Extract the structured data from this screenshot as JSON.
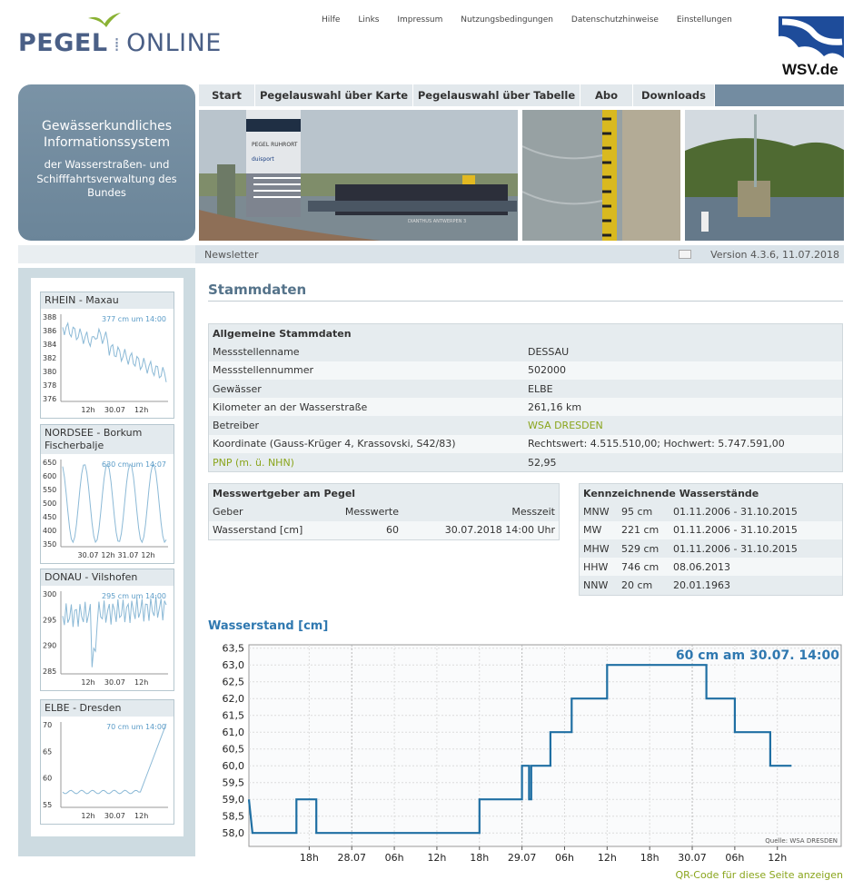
{
  "logo": {
    "part1": "PEGEL",
    "part2": "ONLINE"
  },
  "topnav": [
    "Hilfe",
    "Links",
    "Impressum",
    "Nutzungsbedingungen",
    "Datenschutzhinweise",
    "Einstellungen"
  ],
  "wsv_label": "WSV.de",
  "infobox": {
    "heading": "Gewässerkundliches Informationssystem",
    "sub": "der Wasserstraßen- und Schifffahrtsverwaltung des Bundes"
  },
  "tabs": [
    "Start",
    "Pegelauswahl über Karte",
    "Pegelauswahl über Tabelle",
    "Abo",
    "Downloads"
  ],
  "banner": {
    "sign1": "PEGEL RUHRORT",
    "sign2": "duisport",
    "ship": "DIANTHUS ANTWERPEN 3"
  },
  "newsletter": "Newsletter",
  "version": "Version 4.3.6, 11.07.2018",
  "colors": {
    "accent": "#2f78b0",
    "link": "#8aa51c",
    "nav": "#738ca1",
    "series": "#1f6fa3",
    "mini_series": "#8bb9d6"
  },
  "sidebar": [
    {
      "title": "RHEIN - Maxau",
      "label": "377 cm um 14:00",
      "yticks": [
        "388",
        "386",
        "384",
        "382",
        "380",
        "378",
        "376"
      ],
      "xticks": [
        "12h",
        "30.07",
        "12h"
      ]
    },
    {
      "title": "NORDSEE - Borkum Fischerbalje",
      "label": "630 cm um 14:07",
      "yticks": [
        "650",
        "600",
        "550",
        "500",
        "450",
        "400",
        "350"
      ],
      "xticks": [
        "30.07",
        "12h",
        "31.07",
        "12h"
      ]
    },
    {
      "title": "DONAU - Vilshofen",
      "label": "295 cm um 14:00",
      "yticks": [
        "300",
        "295",
        "290",
        "285"
      ],
      "xticks": [
        "12h",
        "30.07",
        "12h"
      ]
    },
    {
      "title": "ELBE - Dresden",
      "label": "70 cm um 14:00",
      "yticks": [
        "70",
        "65",
        "60",
        "55"
      ],
      "xticks": [
        "12h",
        "30.07",
        "12h"
      ]
    }
  ],
  "stammdaten": {
    "title": "Stammdaten",
    "section": "Allgemeine Stammdaten",
    "rows": [
      {
        "label": "Messstellenname",
        "value": "DESSAU"
      },
      {
        "label": "Messstellennummer",
        "value": "502000"
      },
      {
        "label": "Gewässer",
        "value": "ELBE"
      },
      {
        "label": "Kilometer an der Wasserstraße",
        "value": "261,16 km"
      },
      {
        "label": "Betreiber",
        "value": "WSA DRESDEN"
      },
      {
        "label": "Koordinate (Gauss-Krüger 4, Krassovski, S42/83)",
        "value": "Rechtswert: 4.515.510,00; Hochwert: 5.747.591,00"
      },
      {
        "label": "PNP (m. ü. NHN)",
        "value": "52,95"
      }
    ]
  },
  "messwert": {
    "title": "Messwertgeber am Pegel",
    "headers": [
      "Geber",
      "Messwerte",
      "Messzeit"
    ],
    "row": [
      "Wasserstand [cm]",
      "60",
      "30.07.2018 14:00 Uhr"
    ]
  },
  "kennzeichnend": {
    "title": "Kennzeichnende Wasserstände",
    "rows": [
      {
        "k": "MNW",
        "v": "95 cm",
        "d": "01.11.2006 - 31.10.2015"
      },
      {
        "k": "MW",
        "v": "221 cm",
        "d": "01.11.2006 - 31.10.2015"
      },
      {
        "k": "MHW",
        "v": "529 cm",
        "d": "01.11.2006 - 31.10.2015"
      },
      {
        "k": "HHW",
        "v": "746 cm",
        "d": "08.06.2013"
      },
      {
        "k": "NNW",
        "v": "20 cm",
        "d": "20.01.1963"
      }
    ]
  },
  "chart_data": {
    "type": "line",
    "title": "Wasserstand [cm]",
    "annotation": "60 cm am 30.07. 14:00",
    "source": "Quelle: WSA DRESDEN",
    "ylim": [
      57.6,
      63.6
    ],
    "yticks": [
      "63,5",
      "63,0",
      "62,5",
      "62,0",
      "61,5",
      "61,0",
      "60,5",
      "60,0",
      "59,5",
      "59,0",
      "58,5",
      "58,0"
    ],
    "ytick_values": [
      63.5,
      63.0,
      62.5,
      62.0,
      61.5,
      61.0,
      60.5,
      60.0,
      59.5,
      59.0,
      58.5,
      58.0
    ],
    "xlim_hours": [
      -38.5,
      45
    ],
    "xticks": [
      {
        "label": "18h",
        "h": -30
      },
      {
        "label": "28.07",
        "h": -24
      },
      {
        "label": "06h",
        "h": -18
      },
      {
        "label": "12h",
        "h": -12
      },
      {
        "label": "18h",
        "h": -6
      },
      {
        "label": "29.07",
        "h": 0
      },
      {
        "label": "06h",
        "h": 6
      },
      {
        "label": "12h",
        "h": 12
      },
      {
        "label": "18h",
        "h": 18
      },
      {
        "label": "30.07",
        "h": 24
      },
      {
        "label": "06h",
        "h": 30
      },
      {
        "label": "12h",
        "h": 36
      }
    ],
    "grid": true,
    "series": [
      {
        "values": [
          [
            -38.5,
            59.0
          ],
          [
            -38.0,
            58.0
          ],
          [
            -31.8,
            58.0
          ],
          [
            -31.8,
            59.0
          ],
          [
            -29.0,
            59.0
          ],
          [
            -29.0,
            58.0
          ],
          [
            -6.0,
            58.0
          ],
          [
            -6.0,
            59.0
          ],
          [
            0.0,
            59.0
          ],
          [
            0.0,
            60.0
          ],
          [
            1.0,
            60.0
          ],
          [
            1.0,
            59.0
          ],
          [
            1.3,
            59.0
          ],
          [
            1.3,
            60.0
          ],
          [
            4.0,
            60.0
          ],
          [
            4.0,
            61.0
          ],
          [
            7.0,
            61.0
          ],
          [
            7.0,
            62.0
          ],
          [
            12.0,
            62.0
          ],
          [
            12.0,
            63.0
          ],
          [
            26.0,
            63.0
          ],
          [
            26.0,
            62.0
          ],
          [
            30.0,
            62.0
          ],
          [
            30.0,
            61.0
          ],
          [
            35.0,
            61.0
          ],
          [
            35.0,
            60.0
          ],
          [
            38.0,
            60.0
          ]
        ]
      }
    ]
  }
}
